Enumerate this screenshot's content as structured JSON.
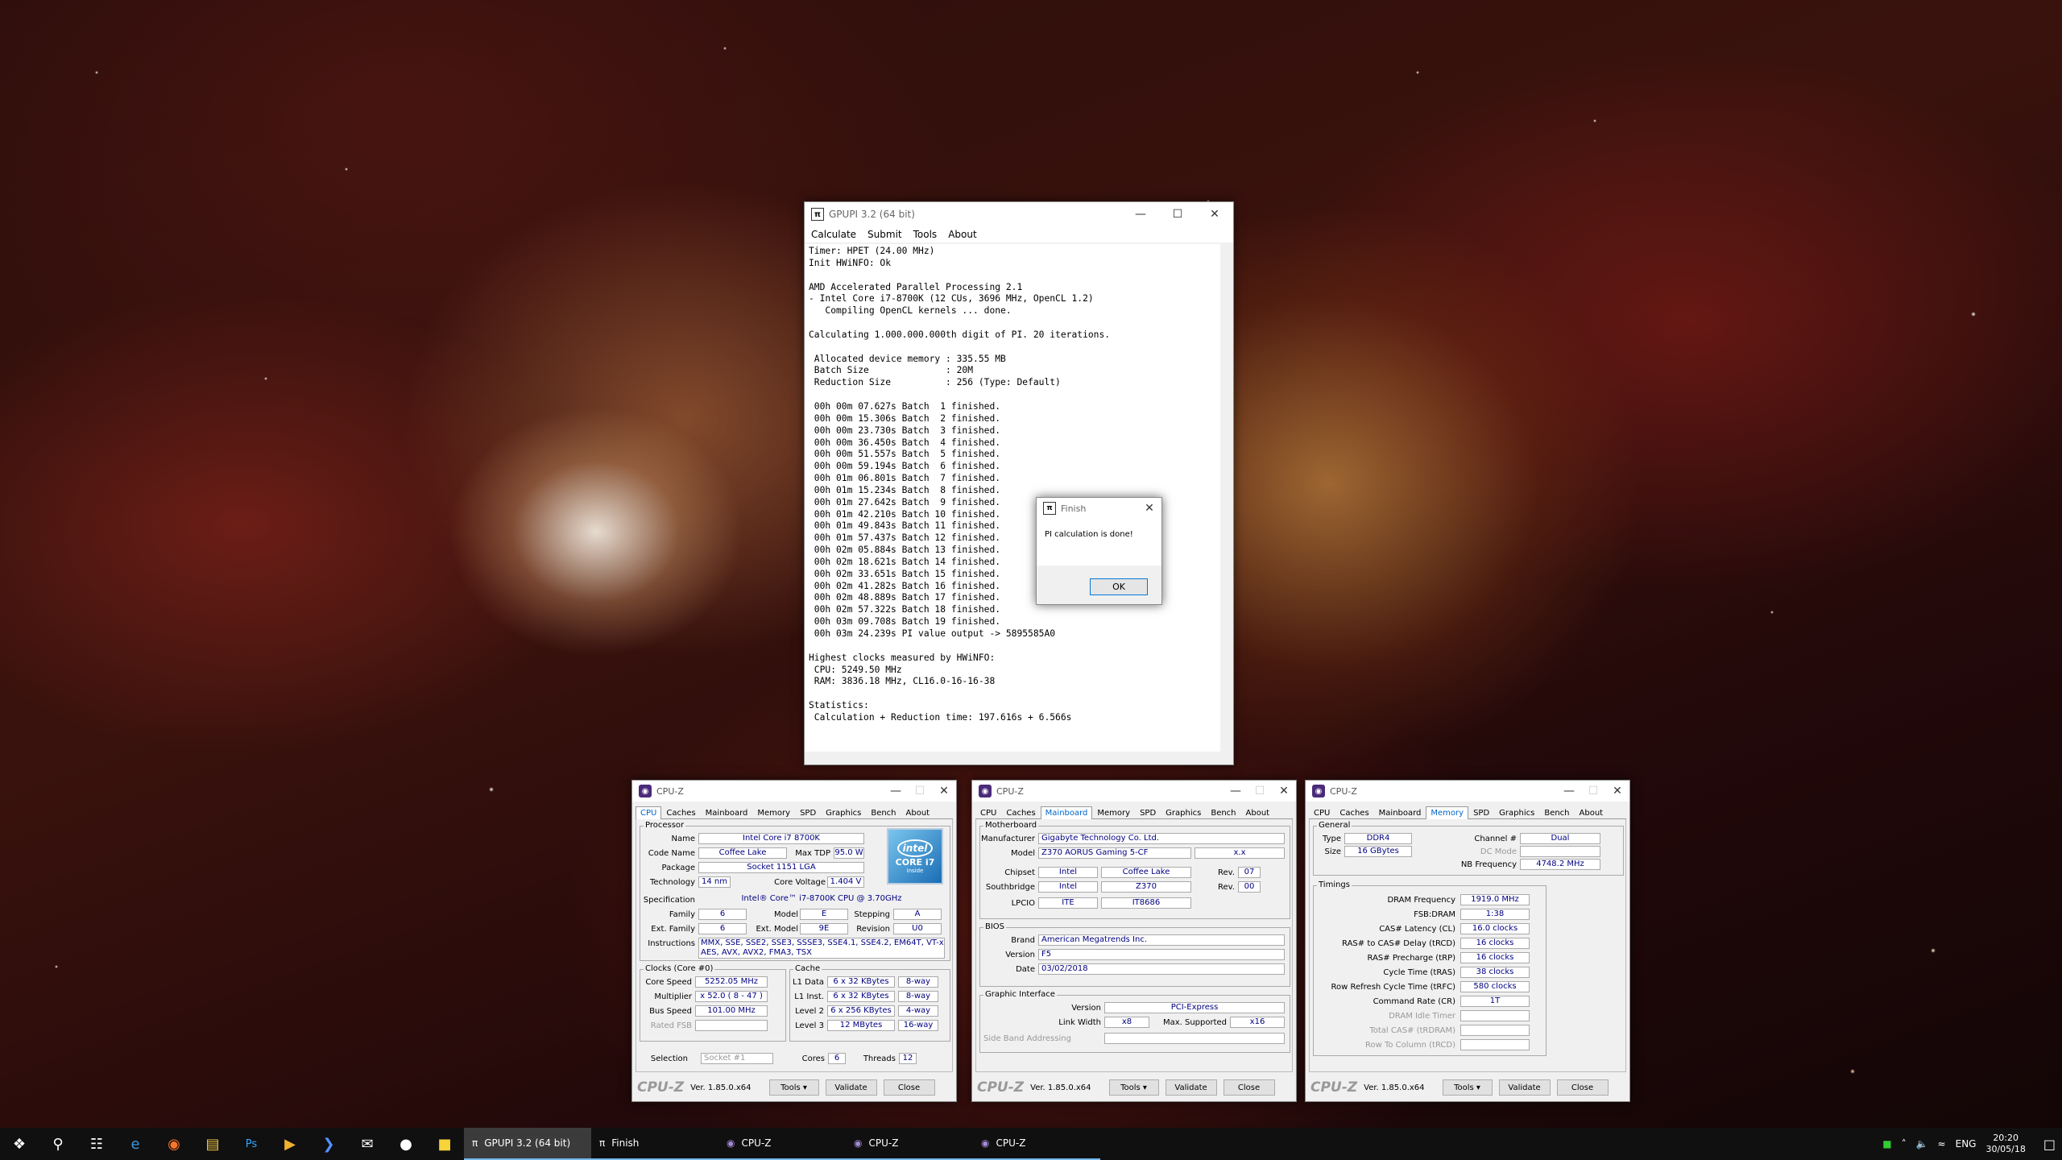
{
  "gpupi": {
    "title": "GPUPI 3.2 (64 bit)",
    "menu": [
      "Calculate",
      "Submit",
      "Tools",
      "About"
    ],
    "console": "Timer: HPET (24.00 MHz)\nInit HWiNFO: Ok\n\nAMD Accelerated Parallel Processing 2.1\n- Intel Core i7-8700K (12 CUs, 3696 MHz, OpenCL 1.2)\n   Compiling OpenCL kernels ... done.\n\nCalculating 1.000.000.000th digit of PI. 20 iterations.\n\n Allocated device memory : 335.55 MB\n Batch Size              : 20M\n Reduction Size          : 256 (Type: Default)\n\n 00h 00m 07.627s Batch  1 finished.\n 00h 00m 15.306s Batch  2 finished.\n 00h 00m 23.730s Batch  3 finished.\n 00h 00m 36.450s Batch  4 finished.\n 00h 00m 51.557s Batch  5 finished.\n 00h 00m 59.194s Batch  6 finished.\n 00h 01m 06.801s Batch  7 finished.\n 00h 01m 15.234s Batch  8 finished.\n 00h 01m 27.642s Batch  9 finished.\n 00h 01m 42.210s Batch 10 finished.\n 00h 01m 49.843s Batch 11 finished.\n 00h 01m 57.437s Batch 12 finished.\n 00h 02m 05.884s Batch 13 finished.\n 00h 02m 18.621s Batch 14 finished.\n 00h 02m 33.651s Batch 15 finished.\n 00h 02m 41.282s Batch 16 finished.\n 00h 02m 48.889s Batch 17 finished.\n 00h 02m 57.322s Batch 18 finished.\n 00h 03m 09.708s Batch 19 finished.\n 00h 03m 24.239s PI value output -> 5895585A0\n\nHighest clocks measured by HWiNFO:\n CPU: 5249.50 MHz\n RAM: 3836.18 MHz, CL16.0-16-16-38\n\nStatistics:\n Calculation + Reduction time: 197.616s + 6.566s"
  },
  "finish": {
    "title": "Finish",
    "message": "PI calculation is done!",
    "ok": "OK"
  },
  "cpuz_common": {
    "title": "CPU-Z",
    "tabs": [
      "CPU",
      "Caches",
      "Mainboard",
      "Memory",
      "SPD",
      "Graphics",
      "Bench",
      "About"
    ],
    "brand": "CPU-Z",
    "version": "Ver. 1.85.0.x64",
    "tools": "Tools",
    "validate": "Validate",
    "close": "Close"
  },
  "cpu": {
    "processor": "Processor",
    "name_l": "Name",
    "name": "Intel Core i7 8700K",
    "codename_l": "Code Name",
    "codename": "Coffee Lake",
    "maxtdp_l": "Max TDP",
    "maxtdp": "95.0 W",
    "package_l": "Package",
    "package": "Socket 1151 LGA",
    "tech_l": "Technology",
    "tech": "14 nm",
    "cv_l": "Core Voltage",
    "cv": "1.404 V",
    "spec_l": "Specification",
    "spec": "Intel® Core™ i7-8700K CPU @ 3.70GHz",
    "family_l": "Family",
    "family": "6",
    "model_l": "Model",
    "model": "E",
    "stepping_l": "Stepping",
    "stepping": "A",
    "extfamily_l": "Ext. Family",
    "extfamily": "6",
    "extmodel_l": "Ext. Model",
    "extmodel": "9E",
    "revision_l": "Revision",
    "revision": "U0",
    "instr_l": "Instructions",
    "instr1": "MMX, SSE, SSE2, SSE3, SSSE3, SSE4.1, SSE4.2, EM64T, VT-x,",
    "instr2": "AES, AVX, AVX2, FMA3, TSX",
    "clocks": "Clocks (Core #0)",
    "corespeed_l": "Core Speed",
    "corespeed": "5252.05 MHz",
    "mult_l": "Multiplier",
    "mult": "x 52.0 ( 8 - 47 )",
    "bus_l": "Bus Speed",
    "bus": "101.00 MHz",
    "rated_l": "Rated FSB",
    "cache": "Cache",
    "l1d_l": "L1 Data",
    "l1d": "6 x 32 KBytes",
    "l1d_w": "8-way",
    "l1i_l": "L1 Inst.",
    "l1i": "6 x 32 KBytes",
    "l1i_w": "8-way",
    "l2_l": "Level 2",
    "l2": "6 x 256 KBytes",
    "l2_w": "4-way",
    "l3_l": "Level 3",
    "l3": "12 MBytes",
    "l3_w": "16-way",
    "sel_l": "Selection",
    "sel": "Socket #1",
    "cores_l": "Cores",
    "cores": "6",
    "threads_l": "Threads",
    "threads": "12",
    "logo_brand": "intel",
    "logo_line1": "CORE i7",
    "logo_line2": "inside"
  },
  "mb": {
    "motherboard": "Motherboard",
    "manu_l": "Manufacturer",
    "manu": "Gigabyte Technology Co. Ltd.",
    "model_l": "Model",
    "model": "Z370 AORUS Gaming 5-CF",
    "model_rev": "x.x",
    "chipset_l": "Chipset",
    "chipset_v": "Intel",
    "chipset": "Coffee Lake",
    "chipset_rev_l": "Rev.",
    "chipset_rev": "07",
    "south_l": "Southbridge",
    "south_v": "Intel",
    "south": "Z370",
    "south_rev_l": "Rev.",
    "south_rev": "00",
    "lpcio_l": "LPCIO",
    "lpcio_v": "ITE",
    "lpcio": "IT8686",
    "bios": "BIOS",
    "brand_l": "Brand",
    "brand": "American Megatrends Inc.",
    "version_l": "Version",
    "version": "F5",
    "date_l": "Date",
    "date": "03/02/2018",
    "gi": "Graphic Interface",
    "giv_l": "Version",
    "giv": "PCI-Express",
    "lw_l": "Link Width",
    "lw": "x8",
    "ms_l": "Max. Supported",
    "ms": "x16",
    "sba_l": "Side Band Addressing"
  },
  "mem": {
    "general": "General",
    "type_l": "Type",
    "type": "DDR4",
    "channel_l": "Channel #",
    "channel": "Dual",
    "size_l": "Size",
    "size": "16 GBytes",
    "dc_l": "DC Mode",
    "nb_l": "NB Frequency",
    "nb": "4748.2 MHz",
    "timings": "Timings",
    "dram_l": "DRAM Frequency",
    "dram": "1919.0 MHz",
    "fsb_l": "FSB:DRAM",
    "fsb": "1:38",
    "cas_l": "CAS# Latency (CL)",
    "cas": "16.0 clocks",
    "rcd_l": "RAS# to CAS# Delay (tRCD)",
    "rcd": "16 clocks",
    "rp_l": "RAS# Precharge (tRP)",
    "rp": "16 clocks",
    "ras_l": "Cycle Time (tRAS)",
    "ras": "38 clocks",
    "rfc_l": "Row Refresh Cycle Time (tRFC)",
    "rfc": "580 clocks",
    "cr_l": "Command Rate (CR)",
    "cr": "1T",
    "idle_l": "DRAM Idle Timer",
    "trdram_l": "Total CAS# (tRDRAM)",
    "trcd_l": "Row To Column (tRCD)"
  },
  "taskbar": {
    "tasks": [
      {
        "label": "GPUPI 3.2 (64 bit)"
      },
      {
        "label": "Finish"
      },
      {
        "label": "CPU-Z"
      },
      {
        "label": "CPU-Z"
      },
      {
        "label": "CPU-Z"
      }
    ],
    "lang": "ENG",
    "time": "20:20",
    "date": "30/05/18"
  }
}
